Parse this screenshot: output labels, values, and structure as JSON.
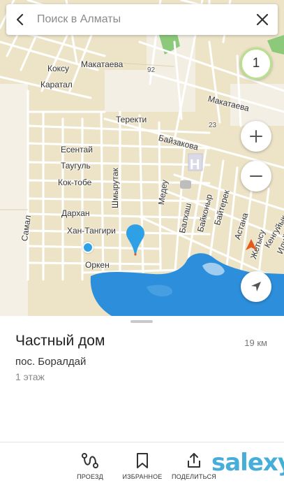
{
  "search": {
    "placeholder": "Поиск в Алматы"
  },
  "map": {
    "traffic_level": "1",
    "house_number_92": "92",
    "house_number_23": "23",
    "streets": {
      "koksu": "Коксу",
      "makataeva_1": "Макатаева",
      "makataeva_2": "Макатаева",
      "karatal": "Каратал",
      "terekti": "Теректи",
      "baizakova": "Байзакова",
      "esentai": "Есентай",
      "taugul": "Таугуль",
      "kok_tobe": "Кок-тобе",
      "shmyrutak": "Шмырутак",
      "medeu": "Медеу",
      "darkhan": "Дархан",
      "khan_tangiri": "Хан-Тангири",
      "orken": "Оркен",
      "samal": "Самал",
      "balkash": "Балхаш",
      "baikonur": "Байконыр",
      "baiterek": "Байтерек",
      "astana": "Астана",
      "zhetysu": "Жетысу",
      "kenguyuk": "Кенгуйык",
      "ilyiskaya": "Илийская"
    },
    "colors": {
      "land": "#ede4c8",
      "block": "#e6dcbc",
      "road": "#ffffff",
      "water": "#2d8fdb",
      "park": "#8cc97a",
      "pin": "#2ea1e6",
      "compass_red": "#e25a1c"
    }
  },
  "controls": {
    "zoom_in_icon": "plus-icon",
    "zoom_out_icon": "minus-icon",
    "locate_icon": "navigation-arrow-icon"
  },
  "place": {
    "title": "Частный дом",
    "distance": "19 км",
    "address": "пос. Боралдай",
    "floors": "1 этаж"
  },
  "actions": {
    "route": "ПРОЕЗД",
    "favorite": "ИЗБРАННОЕ",
    "share": "ПОДЕЛИТЬСЯ"
  },
  "watermark": "salexy"
}
